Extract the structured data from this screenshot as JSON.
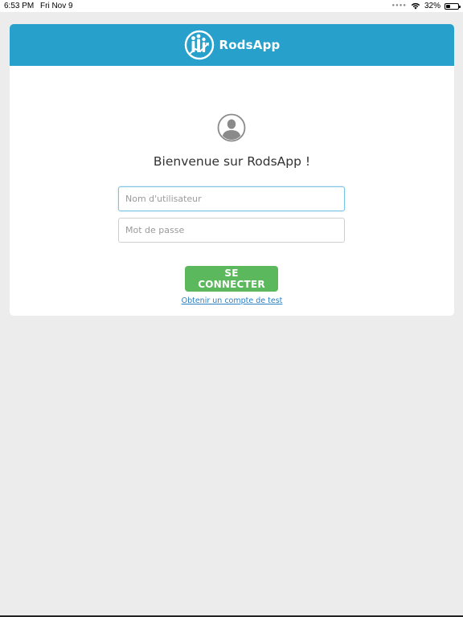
{
  "status_bar": {
    "time": "6:53 PM",
    "date": "Fri Nov 9",
    "battery": "32%",
    "battery_level": 0.32,
    "wifi_icon": "wifi-icon",
    "battery_icon": "battery-icon"
  },
  "header": {
    "app_name": "RodsApp",
    "logo_icon": "rodsapp-logo-icon",
    "color": "#28a0cc"
  },
  "login": {
    "avatar_icon": "user-avatar-icon",
    "welcome": "Bienvenue sur RodsApp !",
    "username_placeholder": "Nom d'utilisateur",
    "password_placeholder": "Mot de passe",
    "connect_label": "SE CONNECTER",
    "connect_color": "#5cb85c",
    "test_account_link": "Obtenir un compte de test",
    "link_color": "#2a7fc1"
  },
  "background_color": "#ececec"
}
